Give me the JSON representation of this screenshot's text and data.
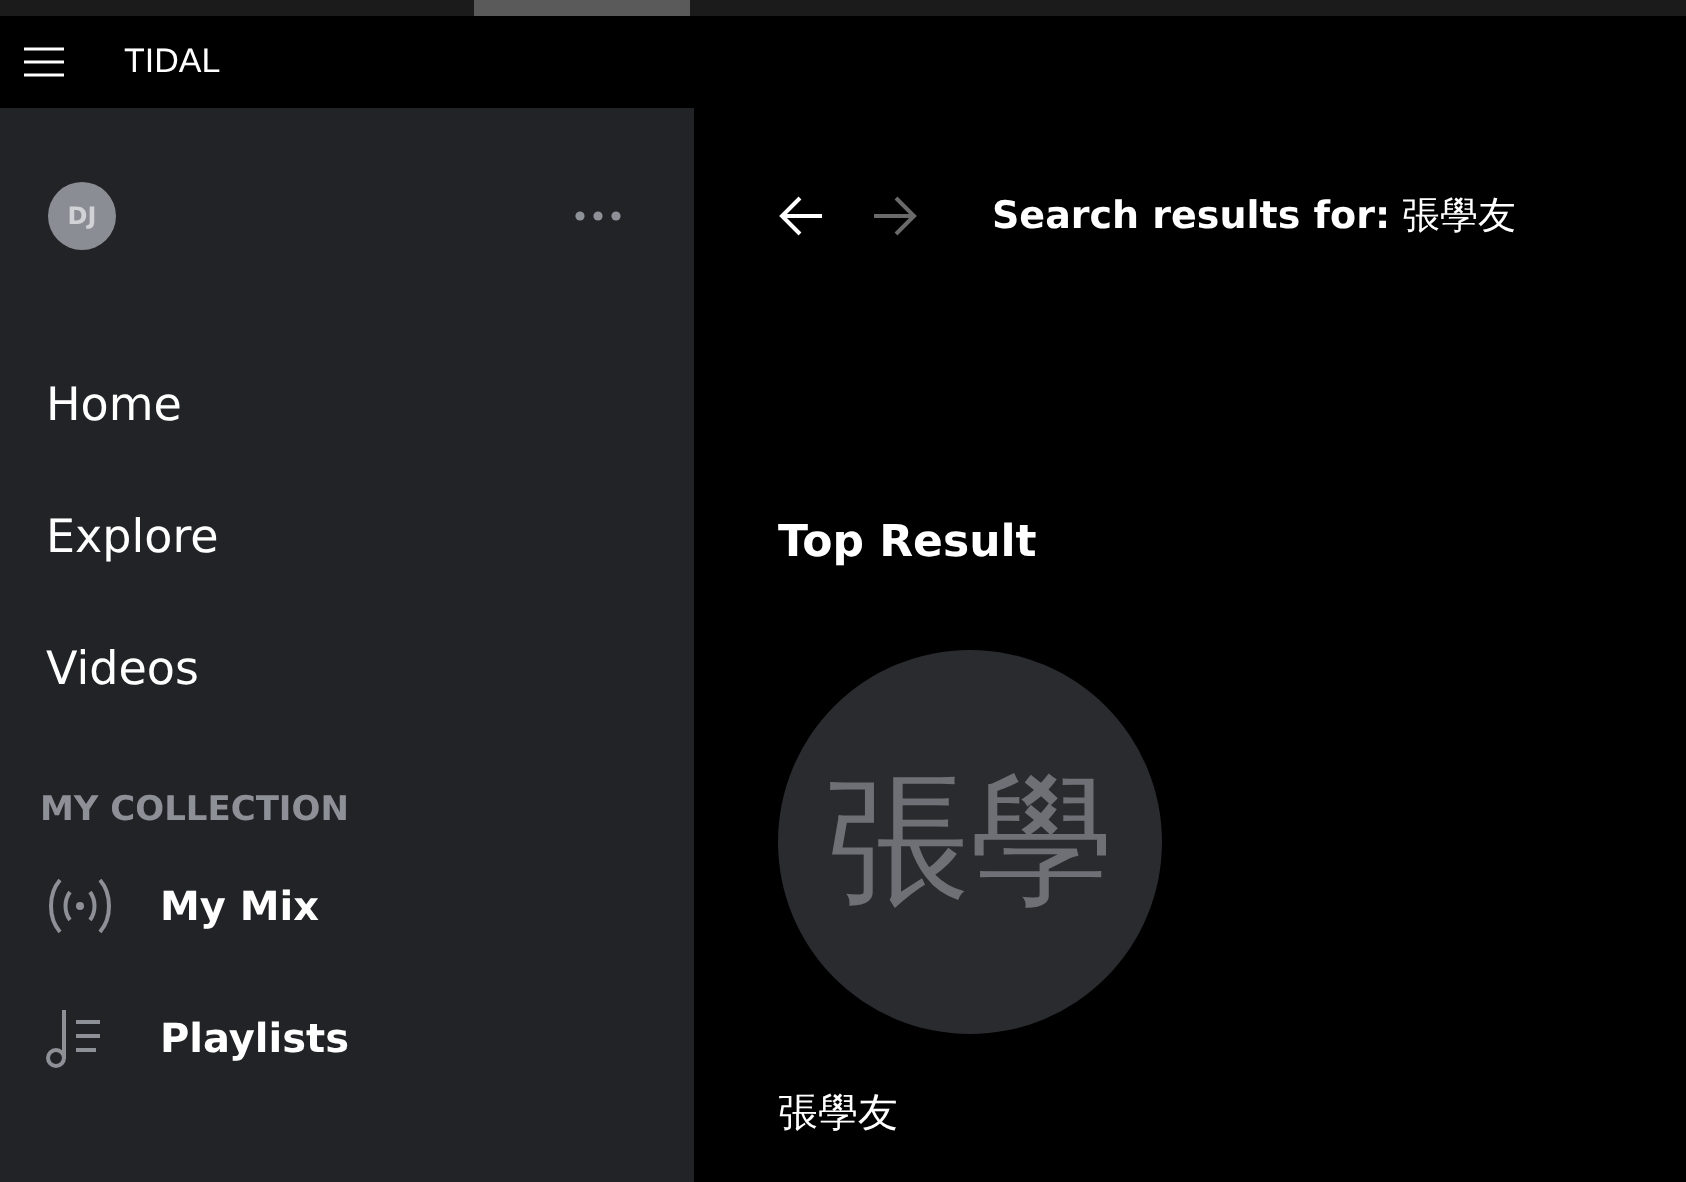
{
  "app": {
    "title": "TIDAL"
  },
  "profile": {
    "initials": "DJ"
  },
  "nav": [
    {
      "label": "Home"
    },
    {
      "label": "Explore"
    },
    {
      "label": "Videos"
    }
  ],
  "collection": {
    "heading": "MY COLLECTION",
    "items": [
      {
        "label": "My Mix",
        "kind": "mix"
      },
      {
        "label": "Playlists",
        "kind": "playlists"
      }
    ]
  },
  "history": {
    "back": {
      "disabled": false
    },
    "forward": {
      "disabled": true
    }
  },
  "search_title": "**Search results for:** 張學友",
  "top_result": {
    "heading": "Top Result",
    "image_text": "張學",
    "name": "張學友"
  }
}
